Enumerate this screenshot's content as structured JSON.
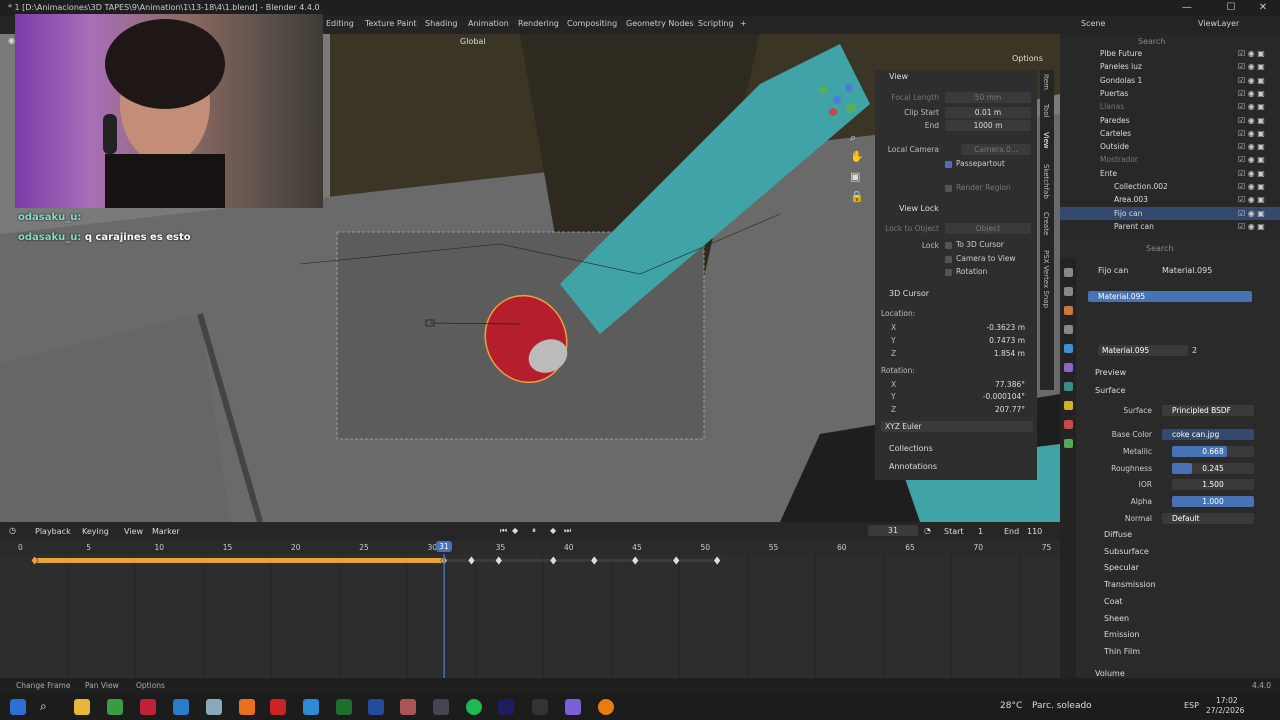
{
  "window": {
    "title": "* 1 [D:\\Animaciones\\3D TAPES\\9\\Animation\\1\\13-18\\4\\1.blend] - Blender 4.4.0",
    "minimize": "—",
    "maximize": "☐",
    "close": "✕"
  },
  "workspaces": [
    "Editing",
    "Texture Paint",
    "Shading",
    "Animation",
    "Rendering",
    "Compositing",
    "Geometry Nodes",
    "Scripting",
    "+"
  ],
  "scene": {
    "label": "Scene",
    "viewlayer": "ViewLayer"
  },
  "viewport_header": {
    "orientation": "Global",
    "options": "Options"
  },
  "chat": [
    {
      "user": "odasaku_u:",
      "message": ""
    },
    {
      "user": "odasaku_u:",
      "message": "q carajines es esto"
    }
  ],
  "npanel": {
    "view_title": "View",
    "focal_label": "Focal Length",
    "focal_value": "50 mm",
    "clip_start_label": "Clip Start",
    "clip_start_value": "0.01 m",
    "end_label": "End",
    "end_value": "1000 m",
    "local_camera_label": "Local Camera",
    "local_camera_value": "Camera.0...",
    "passepartout": "Passepartout",
    "render_region": "Render Region",
    "view_lock_title": "View Lock",
    "lock_to_object_label": "Lock to Object",
    "lock_to_object_value": "Object",
    "lock_label": "Lock",
    "to_3d_cursor": "To 3D Cursor",
    "camera_to_view": "Camera to View",
    "rotation": "Rotation",
    "cursor_title": "3D Cursor",
    "location_label": "Location:",
    "loc_x": "-0.3623 m",
    "loc_y": "0.7473 m",
    "loc_z": "1.854 m",
    "rotation_label": "Rotation:",
    "rot_x": "77.386°",
    "rot_y": "-0.000104°",
    "rot_z": "207.77°",
    "euler": "XYZ Euler",
    "collections": "Collections",
    "annotations": "Annotations",
    "axis_x": "X",
    "axis_y": "Y",
    "axis_z": "Z"
  },
  "vtabs": [
    "Item",
    "Tool",
    "View",
    "Sketchfab",
    "Create",
    "PSX Vertex Snap"
  ],
  "timeline": {
    "menus": [
      "Playback",
      "Keying",
      "View",
      "Marker"
    ],
    "current_frame": "31",
    "start_label": "Start",
    "start_value": "1",
    "end_label": "End",
    "end_value": "110",
    "ticks": [
      "0",
      "5",
      "10",
      "15",
      "20",
      "25",
      "30",
      "35",
      "40",
      "45",
      "50",
      "55",
      "60",
      "65",
      "70",
      "75"
    ],
    "playhead": "31",
    "keyframes": [
      1,
      31,
      33,
      35,
      39,
      42,
      45,
      48,
      51
    ]
  },
  "statusbar": {
    "change_frame": "Change Frame",
    "pan_view": "Pan View",
    "options": "Options",
    "version": "4.4.0"
  },
  "taskbar": {
    "weather_temp": "28°C",
    "weather_desc": "Parc. soleado",
    "lang": "ESP",
    "time": "17:02",
    "date": "27/2/2026"
  },
  "outliner": {
    "search_placeholder": "Search",
    "items": [
      {
        "name": "Pibe Future",
        "dim": false,
        "sel": false
      },
      {
        "name": "Paneles luz",
        "dim": false,
        "sel": false
      },
      {
        "name": "Gondolas 1",
        "dim": false,
        "sel": false
      },
      {
        "name": "Puertas",
        "dim": false,
        "sel": false
      },
      {
        "name": "Llanas",
        "dim": true,
        "sel": false
      },
      {
        "name": "Paredes",
        "dim": false,
        "sel": false
      },
      {
        "name": "Carteles",
        "dim": false,
        "sel": false
      },
      {
        "name": "Outside",
        "dim": false,
        "sel": false
      },
      {
        "name": "Mostrador",
        "dim": true,
        "sel": false
      },
      {
        "name": "Ente",
        "dim": false,
        "sel": false
      },
      {
        "name": "Collection.002",
        "dim": false,
        "sel": false
      },
      {
        "name": "Area.003",
        "dim": false,
        "sel": false
      },
      {
        "name": "Fijo can",
        "dim": false,
        "sel": true
      },
      {
        "name": "Parent can",
        "dim": false,
        "sel": false
      }
    ]
  },
  "properties": {
    "search_placeholder": "Search",
    "breadcrumb_object": "Fijo can",
    "breadcrumb_material": "Material.095",
    "slot": "Material.095",
    "material_name": "Material.095",
    "users": "2",
    "preview": "Preview",
    "surface": "Surface",
    "surface_label": "Surface",
    "surface_value": "Principled BSDF",
    "base_color_label": "Base Color",
    "base_color_value": "coke can.jpg",
    "metallic_label": "Metallic",
    "metallic": 0.668,
    "metallic_text": "0.668",
    "roughness_label": "Roughness",
    "roughness": 0.245,
    "roughness_text": "0.245",
    "ior_label": "IOR",
    "ior_text": "1.500",
    "alpha_label": "Alpha",
    "alpha": 1.0,
    "alpha_text": "1.000",
    "normal_label": "Normal",
    "normal_value": "Default",
    "subsections": [
      "Diffuse",
      "Subsurface",
      "Specular",
      "Transmission",
      "Coat",
      "Sheen",
      "Emission",
      "Thin Film"
    ],
    "volume": "Volume"
  },
  "colors": {
    "accent": "#4772b3",
    "keyframe": "#e8a33a",
    "playhead": "#4772b3",
    "can": "#b51e2c",
    "arm": "#3fa3a8"
  }
}
